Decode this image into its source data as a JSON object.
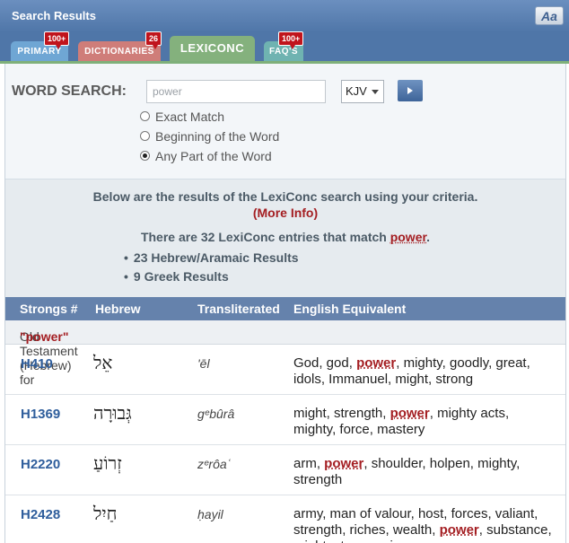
{
  "header": {
    "title": "Search Results",
    "font_button": "Aa"
  },
  "tabs": [
    {
      "label": "PRIMARY",
      "badge": "100+",
      "color": "#6fa6d4"
    },
    {
      "label": "DICTIONARIES",
      "badge": "26",
      "color": "#cf7d79"
    },
    {
      "label": "LEXICONC",
      "badge": "",
      "color": "#84b17d"
    },
    {
      "label": "FAQ'S",
      "badge": "100+",
      "color": "#6fb3b1"
    }
  ],
  "search": {
    "label": "WORD SEARCH:",
    "value": "power",
    "version": "KJV",
    "options": [
      {
        "label": "Exact Match",
        "selected": false
      },
      {
        "label": "Beginning of the Word",
        "selected": false
      },
      {
        "label": "Any Part of the Word",
        "selected": true
      }
    ]
  },
  "results": {
    "intro": "Below are the results of the LexiConc search using your criteria.",
    "more_info": "(More Info)",
    "count_prefix": "There are 32 LexiConc entries that match ",
    "count_term": "power",
    "count_suffix": ".",
    "bullets": [
      "23 Hebrew/Aramaic Results",
      "9 Greek Results"
    ]
  },
  "table": {
    "columns": [
      "Strongs #",
      "Hebrew",
      "Transliterated",
      "English Equivalent"
    ],
    "section_prefix": "Old Testament (Hebrew) for ",
    "section_term": "\"power\"",
    "rows": [
      {
        "strongs": "H410",
        "hebrew": "אֵל",
        "translit": "'ēl",
        "english": [
          {
            "t": "God, god, "
          },
          {
            "t": "power",
            "hl": true
          },
          {
            "t": ", mighty, goodly, great, idols, Immanuel, might, strong"
          }
        ]
      },
      {
        "strongs": "H1369",
        "hebrew": "גְּבוּרָה",
        "translit": "gᵉbûrâ",
        "english": [
          {
            "t": "might, strength, "
          },
          {
            "t": "power",
            "hl": true
          },
          {
            "t": ", mighty acts, mighty, force, mastery"
          }
        ]
      },
      {
        "strongs": "H2220",
        "hebrew": "זְרוֹעַ",
        "translit": "zᵉrôaʿ",
        "english": [
          {
            "t": "arm, "
          },
          {
            "t": "power",
            "hl": true
          },
          {
            "t": ", shoulder, holpen, mighty, strength"
          }
        ]
      },
      {
        "strongs": "H2428",
        "hebrew": "חַיִל",
        "translit": "ḥayil",
        "english": [
          {
            "t": "army, man of valour, host, forces, valiant, strength, riches, wealth, "
          },
          {
            "t": "power",
            "hl": true
          },
          {
            "t": ", substance, might, strong, misc"
          }
        ]
      }
    ]
  }
}
